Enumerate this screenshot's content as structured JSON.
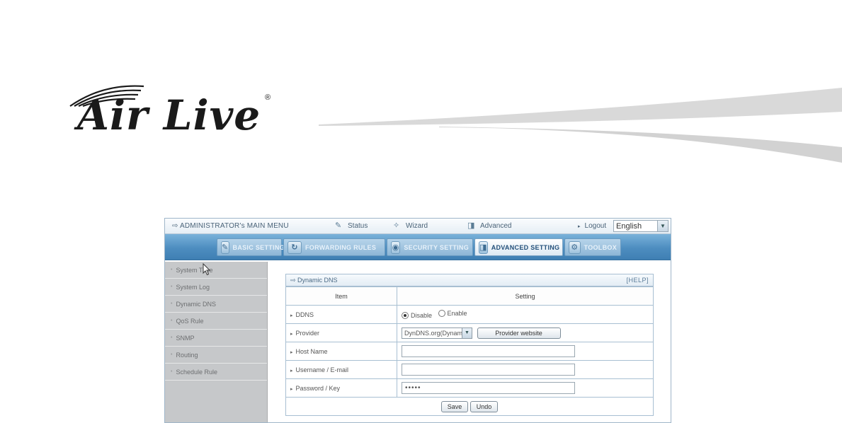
{
  "logo": {
    "text": "Air Live",
    "reg_mark": "®"
  },
  "topbar": {
    "menu_title": "ADMINISTRATOR's MAIN MENU",
    "status": "Status",
    "wizard": "Wizard",
    "advanced": "Advanced",
    "logout": "Logout",
    "language": "English"
  },
  "nav": {
    "tabs": [
      {
        "label": "BASIC SETTING",
        "icon": "basic-setting-icon"
      },
      {
        "label": "FORWARDING RULES",
        "icon": "forwarding-icon"
      },
      {
        "label": "SECURITY SETTING",
        "icon": "security-icon"
      },
      {
        "label": "ADVANCED SETTING",
        "icon": "advanced-icon",
        "active": true
      },
      {
        "label": "TOOLBOX",
        "icon": "toolbox-icon"
      }
    ]
  },
  "sidebar": {
    "items": [
      {
        "label": "System Time"
      },
      {
        "label": "System Log"
      },
      {
        "label": "Dynamic DNS"
      },
      {
        "label": "QoS Rule"
      },
      {
        "label": "SNMP"
      },
      {
        "label": "Routing"
      },
      {
        "label": "Schedule Rule"
      }
    ]
  },
  "panel": {
    "title": "Dynamic DNS",
    "help": "[HELP]",
    "col_item": "Item",
    "col_setting": "Setting",
    "rows": {
      "ddns": {
        "label": "DDNS",
        "opt_disable": "Disable",
        "opt_enable": "Enable",
        "selected": "Disable"
      },
      "provider": {
        "label": "Provider",
        "value": "DynDNS.org(Dynamic)",
        "button": "Provider website"
      },
      "hostname": {
        "label": "Host Name",
        "value": ""
      },
      "username": {
        "label": "Username / E-mail",
        "value": ""
      },
      "password": {
        "label": "Password / Key",
        "value": "•••••"
      }
    },
    "save": "Save",
    "undo": "Undo"
  },
  "colors": {
    "nav_blue": "#4d8dc0",
    "sidebar_gray": "#c6c8ca",
    "border_blue": "#a8bfd2"
  }
}
